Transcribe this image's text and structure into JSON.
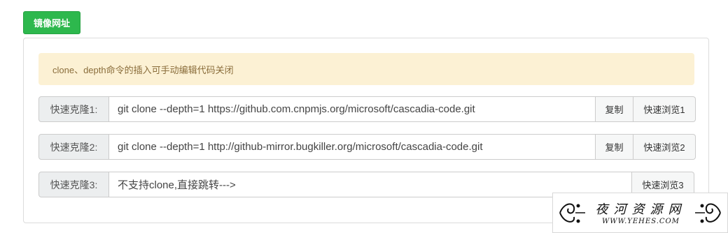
{
  "header": {
    "mirror_button_label": "镜像网址"
  },
  "notice": {
    "text": "clone、depth命令的插入可手动编辑代码关闭"
  },
  "rows": [
    {
      "label": "快速克隆1:",
      "value": "git clone --depth=1 https://github.com.cnpmjs.org/microsoft/cascadia-code.git",
      "copy_label": "复制",
      "browse_label": "快速浏览1"
    },
    {
      "label": "快速克隆2:",
      "value": "git clone --depth=1 http://github-mirror.bugkiller.org/microsoft/cascadia-code.git",
      "copy_label": "复制",
      "browse_label": "快速浏览2"
    },
    {
      "label": "快速克隆3:",
      "value": "不支持clone,直接跳转--->",
      "browse_label": "快速浏览3"
    }
  ],
  "watermark": {
    "title": "夜河资源网",
    "subtitle": "WWW.YEHES.COM"
  },
  "colors": {
    "primary_green": "#2db84d",
    "notice_bg": "#fcf1d4",
    "notice_text": "#8a6d3b",
    "addon_bg": "#eceeef"
  }
}
